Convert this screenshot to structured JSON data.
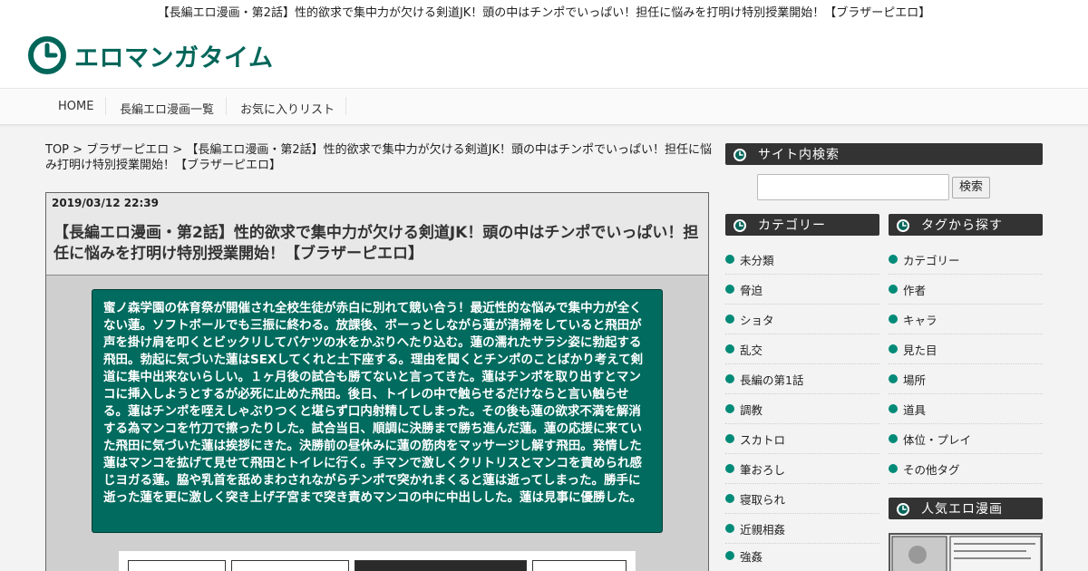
{
  "site": {
    "tagline": "【長編エロ漫画・第2話】性的欲求で集中力が欠ける剣道JK！頭の中はチンポでいっぱい！担任に悩みを打明け特別授業開始！【ブラザーピエロ】",
    "logo_text": "エロマンガタイム",
    "brand_color": "#00665a"
  },
  "nav": {
    "items": [
      "HOME",
      "長編エロ漫画一覧",
      "お気に入りリスト"
    ]
  },
  "breadcrumb": {
    "home": "TOP",
    "sep": ">",
    "category": "ブラザーピエロ",
    "current": "【長編エロ漫画・第2話】性的欲求で集中力が欠ける剣道JK！頭の中はチンポでいっぱい！担任に悩み打明け特別授業開始！【ブラザーピエロ】"
  },
  "article": {
    "date": "2019/03/12  22:39",
    "title": "【長編エロ漫画・第2話】性的欲求で集中力が欠ける剣道JK！頭の中はチンポでいっぱい！担任に悩みを打明け特別授業開始！【ブラザーピエロ】",
    "summary": "蜜ノ森学園の体育祭が開催され全校生徒が赤白に別れて競い合う！最近性的な悩みで集中力が全くない蓮。ソフトボールでも三振に終わる。放課後、ボーっとしながら蓮が清掃をしていると飛田が声を掛け肩を叩くとビックリしてバケツの水をかぶりへたり込む。蓮の濡れたサラシ姿に勃起する飛田。勃起に気づいた蓮はSEXしてくれと土下座する。理由を聞くとチンポのことばかり考えて剣道に集中出来ないらしい。１ヶ月後の試合も勝てないと言ってきた。蓮はチンポを取り出すとマンコに挿入しようとするが必死に止めた飛田。後日、トイレの中で触らせるだけならと言い触らせる。蓮はチンポを咥えしゃぶりつくと堪らず口内射精してしまった。その後も蓮の欲求不満を解消する為マンコを竹刀で擦ったりした。試合当日、順調に決勝まで勝ち進んだ蓮。蓮の応援に来ていた飛田に気づいた蓮は挨拶にきた。決勝前の昼休みに蓮の筋肉をマッサージし解す飛田。発情した蓮はマンコを拡げて見せて飛田とトイレに行く。手マンで激しくクリトリスとマンコを責められ感じヨガる蓮。脇や乳首を舐めまわされながらチンポで突かれまくると蓮は逝ってしまった。勝手に逝った蓮を更に激しく突き上げ子宮まで突き責めマンコの中に中出しした。蓮は見事に優勝した。"
  },
  "sidebar": {
    "search": {
      "heading": "サイト内検索",
      "button_label": "検索",
      "placeholder": ""
    },
    "categories": {
      "heading": "カテゴリー",
      "items": [
        "未分類",
        "脅迫",
        "ショタ",
        "乱交",
        "長編の第1話",
        "調教",
        "スカトロ",
        "筆おろし",
        "寝取られ",
        "近親相姦",
        "強姦"
      ]
    },
    "tags": {
      "heading": "タグから探す",
      "items": [
        "カテゴリー",
        "作者",
        "キャラ",
        "見た目",
        "場所",
        "道具",
        "体位・プレイ",
        "その他タグ"
      ]
    },
    "popular": {
      "heading": "人気エロ漫画"
    }
  }
}
